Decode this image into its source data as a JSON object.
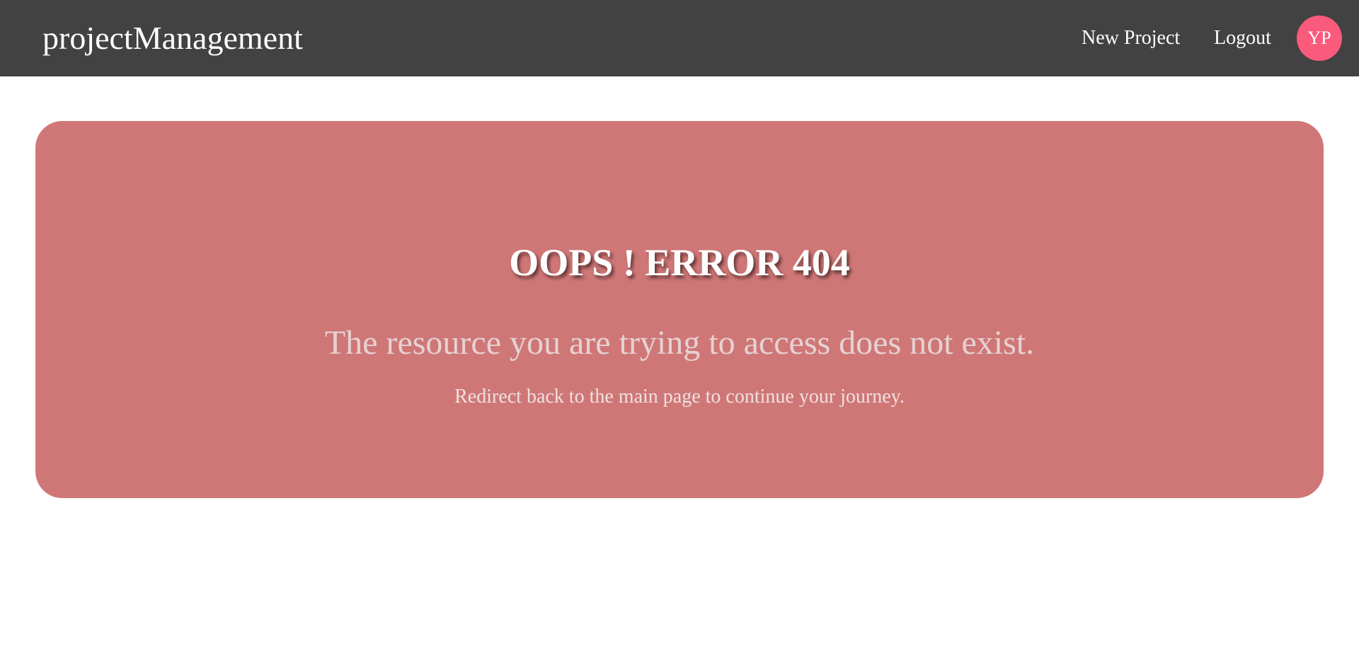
{
  "navbar": {
    "brand": "projectManagement",
    "links": {
      "new_project": "New Project",
      "logout": "Logout"
    },
    "avatar_initials": "YP",
    "colors": {
      "background": "#424242",
      "avatar": "#fa5a7c"
    }
  },
  "error": {
    "title": "OOPS ! ERROR 404",
    "message": "The resource you are trying to access does not exist.",
    "hint": "Redirect back to the main page to continue your journey.",
    "colors": {
      "card": "#cf7777"
    }
  }
}
